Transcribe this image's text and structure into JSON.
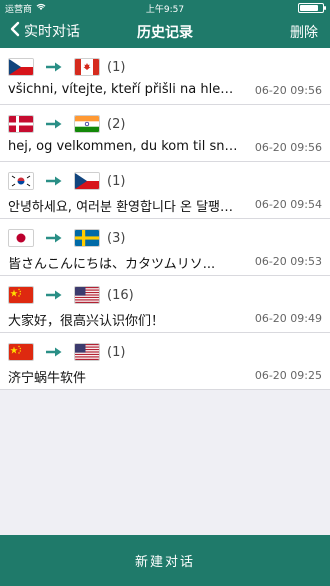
{
  "status_bar": {
    "carrier": "运营商",
    "time": "上午9:57"
  },
  "header": {
    "back_label": "实时对话",
    "title": "历史记录",
    "delete_label": "删除"
  },
  "history": [
    {
      "from_flag": "czech-republic-flag-icon",
      "to_flag": "canada-flag-icon",
      "count": "(1)",
      "text": "všichni, vítejte, kteří přišli na hlemýž...",
      "time": "06-20 09:56"
    },
    {
      "from_flag": "denmark-flag-icon",
      "to_flag": "india-flag-icon",
      "count": "(2)",
      "text": "hej, og velkommen, du kom til snegl...",
      "time": "06-20 09:56"
    },
    {
      "from_flag": "south-korea-flag-icon",
      "to_flag": "czech-republic-flag-icon",
      "count": "(1)",
      "text": "안녕하세요, 여러분 환영합니다 온 달팽이...",
      "time": "06-20 09:54"
    },
    {
      "from_flag": "japan-flag-icon",
      "to_flag": "sweden-flag-icon",
      "count": "(3)",
      "text": "皆さんこんにちは、カタツムリソ...",
      "time": "06-20 09:53"
    },
    {
      "from_flag": "china-flag-icon",
      "to_flag": "united-states-flag-icon",
      "count": "(16)",
      "text": "大家好，很高兴认识你们！",
      "time": "06-20 09:49"
    },
    {
      "from_flag": "china-flag-icon",
      "to_flag": "united-states-flag-icon",
      "count": "(1)",
      "text": "济宁蜗牛软件",
      "time": "06-20 09:25"
    }
  ],
  "footer": {
    "new_chat_label": "新建对话"
  },
  "colors": {
    "primary": "#1f7a6a",
    "arrow": "#2a8f86",
    "background": "#efeff4"
  }
}
